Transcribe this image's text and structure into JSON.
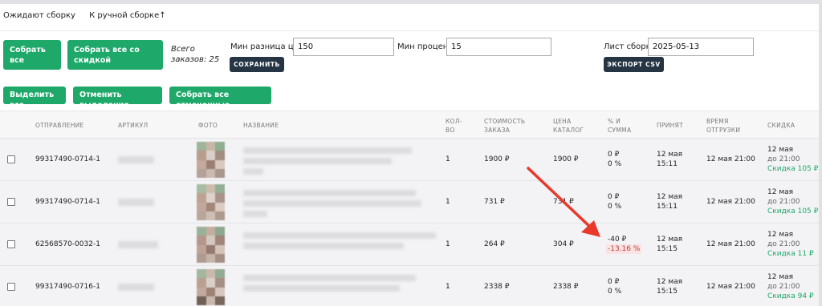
{
  "tabs": [
    "Ожидают сборку",
    "К ручной сборке↑"
  ],
  "toolbar": {
    "collect_all": "Собрать все",
    "collect_all_discount": "Собрать все со скидкой",
    "total_orders": "Всего заказов: 25",
    "min_price_diff_label": "Мин разница цен:",
    "min_price_diff_value": "150",
    "min_percent_label": "Мин процент:",
    "min_percent_value": "15",
    "save_label": "СОХРАНИТЬ",
    "sheet_label": "Лист сборки:",
    "sheet_value": "2025-05-13",
    "export_label": "ЭКСПОРТ CSV"
  },
  "actions": {
    "select_all": "Выделить все",
    "deselect": "Отменить выделение",
    "collect_selected": "Собрать все отмеченные"
  },
  "columns": {
    "shipment": "ОТПРАВЛЕНИЕ",
    "article": "АРТИКУЛ",
    "photo": "ФОТО",
    "name": "НАЗВАНИЕ",
    "qty_1": "КОЛ-",
    "qty_2": "ВО",
    "cost_1": "СТОИМОСТЬ",
    "cost_2": "ЗАКАЗА",
    "price_1": "ЦЕНА",
    "price_2": "КАТАЛОГ",
    "pct_1": "% И",
    "pct_2": "СУММА",
    "accepted": "ПРИНЯТ",
    "ship_time_1": "ВРЕМЯ",
    "ship_time_2": "ОТГРУЗКИ",
    "discount": "СКИДКА"
  },
  "rows": [
    {
      "shipment": "99317490-0714-1",
      "qty": "1",
      "cost": "1900 ₽",
      "price": "1900 ₽",
      "diff": "0 ₽",
      "pct": "0 %",
      "accepted_date": "12 мая",
      "accepted_time": "15:11",
      "ship_time": "12 мая 21:00",
      "disc_date": "12 мая",
      "disc_until": "до 21:00",
      "disc_value": "Скидка 105 ₽",
      "negative": false
    },
    {
      "shipment": "99317490-0714-1",
      "qty": "1",
      "cost": "731 ₽",
      "price": "731 ₽",
      "diff": "0 ₽",
      "pct": "0 %",
      "accepted_date": "12 мая",
      "accepted_time": "15:11",
      "ship_time": "12 мая 21:00",
      "disc_date": "12 мая",
      "disc_until": "до 21:00",
      "disc_value": "Скидка 105 ₽",
      "negative": false
    },
    {
      "shipment": "62568570-0032-1",
      "qty": "1",
      "cost": "264 ₽",
      "price": "304 ₽",
      "diff": "-40 ₽",
      "pct": "-13.16 %",
      "accepted_date": "12 мая",
      "accepted_time": "15:15",
      "ship_time": "12 мая 21:00",
      "disc_date": "12 мая",
      "disc_until": "до 21:00",
      "disc_value": "Скидка 11 ₽",
      "negative": true
    },
    {
      "shipment": "99317490-0716-1",
      "qty": "1",
      "cost": "2338 ₽",
      "price": "2338 ₽",
      "diff": "0 ₽",
      "pct": "0 %",
      "accepted_date": "12 мая",
      "accepted_time": "15:15",
      "ship_time": "12 мая 21:00",
      "disc_date": "12 мая",
      "disc_until": "до 21:00",
      "disc_value": "Скидка 94 ₽",
      "negative": false
    }
  ],
  "colors": {
    "accent_green": "#1ea86a",
    "dark_button": "#263544",
    "annotation_arrow": "#e8392b",
    "negative_text": "#c23a3a"
  }
}
